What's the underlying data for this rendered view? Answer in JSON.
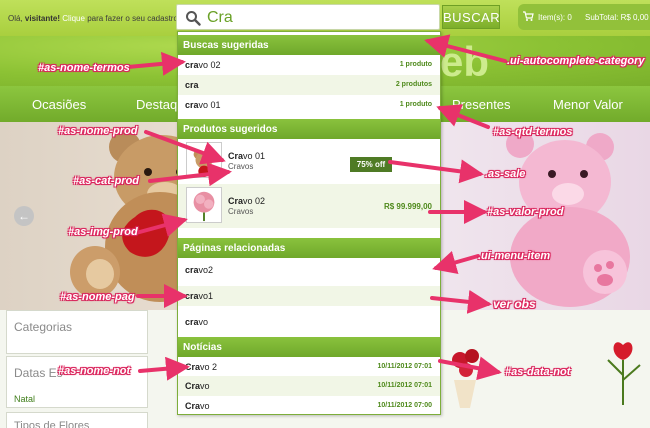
{
  "header": {
    "greeting_prefix": "Olá,",
    "greeting_name": "visitante!",
    "greeting_link": "Clique",
    "greeting_suffix": "para fazer o seu cadastro.",
    "search_value": "Cra",
    "search_button": "BUSCAR",
    "cart_items": "Item(s): 0",
    "cart_subtotal": "SubTotal: R$ 0,00",
    "logo_fragment": "eb"
  },
  "nav": [
    "Ocasiões",
    "Destaques",
    "Presentes",
    "Menor Valor"
  ],
  "hero": {
    "prev_arrow": "←"
  },
  "sidebar": {
    "categories_title": "Categorias",
    "dates_title": "Datas Es",
    "dates_link": "Natal",
    "flower_title": "Tipos de Flores"
  },
  "autocomplete": {
    "terms_header": "Buscas sugeridas",
    "terms": [
      {
        "match": "cra",
        "rest": "vo 02",
        "qty": "1 produto"
      },
      {
        "match": "cra",
        "rest": "",
        "qty": "2 produtos"
      },
      {
        "match": "cra",
        "rest": "vo 01",
        "qty": "1 produto"
      }
    ],
    "products_header": "Produtos sugeridos",
    "products": [
      {
        "match": "Cra",
        "rest": "vo 01",
        "category": "Cravos",
        "sale": "75% off",
        "price": ""
      },
      {
        "match": "Cra",
        "rest": "vo 02",
        "category": "Cravos",
        "sale": "",
        "price": "R$ 99.999,00"
      }
    ],
    "pages_header": "Páginas relacionadas",
    "pages": [
      {
        "match": "cra",
        "rest": "vo2"
      },
      {
        "match": "cra",
        "rest": "vo1"
      },
      {
        "match": "cra",
        "rest": "vo"
      }
    ],
    "news_header": "Notícias",
    "news": [
      {
        "match": "Cra",
        "rest": "vo 2",
        "date": "10/11/2012 07:01"
      },
      {
        "match": "Cra",
        "rest": "vo",
        "date": "10/11/2012 07:01"
      },
      {
        "match": "Cra",
        "rest": "vo",
        "date": "10/11/2012 07:00"
      }
    ]
  },
  "labels": {
    "as_nome_termos": "#as-nome-termos",
    "ui_autocomplete_category": ".ui-autocomplete-category",
    "as_qtd_termos": "#as-qtd-termos",
    "as_nome_prod": "#as-nome-prod",
    "as_cat_prod": "#as-cat-prod",
    "as_sale": ".as-sale",
    "as_img_prod": "#as-img-prod",
    "as_valor_prod": "#as-valor-prod",
    "ui_menu_item": ".ui-menu-item",
    "as_nome_pag": "#as-nome-pag",
    "ver_obs": "ver obs",
    "as_nome_not": "#as-nome-not",
    "as_data_not": "#as-data-not"
  },
  "colors": {
    "brand_green": "#8cc63f",
    "callout_pink": "#e8326a"
  }
}
